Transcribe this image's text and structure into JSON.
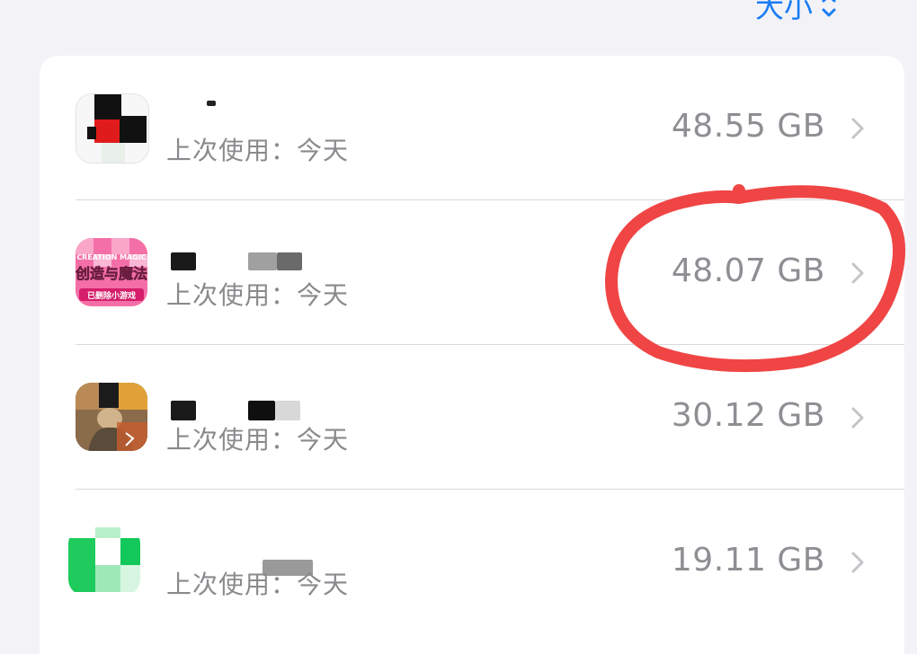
{
  "header": {
    "sort_label": "大小"
  },
  "apps": [
    {
      "icon": "app-icon-1",
      "last_used": "上次使用：今天",
      "size": "48.55 GB"
    },
    {
      "icon": "creation-magic-icon",
      "icon_text_top": "CREATION MAGIC",
      "icon_text_main": "创造与魔法",
      "icon_text_bottom": "已删除小游戏",
      "last_used": "上次使用：今天",
      "size": "48.07 GB"
    },
    {
      "icon": "pubg-icon",
      "last_used": "上次使用：今天",
      "size": "30.12 GB"
    },
    {
      "icon": "green-app-icon",
      "last_used": "上次使用：今天",
      "size": "19.11 GB"
    }
  ],
  "colors": {
    "accent": "#1a7cf5",
    "annotation": "#f04545",
    "background": "#f2f2f7"
  }
}
